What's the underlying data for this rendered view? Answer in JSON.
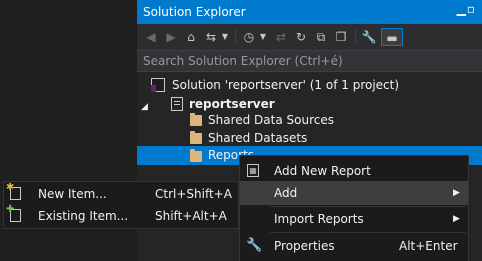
{
  "solution_explorer": {
    "title": "Solution Explorer",
    "title_pin": "–▫",
    "search_placeholder": "Search Solution Explorer (Ctrl+é)",
    "tree": {
      "solution_label": "Solution 'reportserver' (1 of 1 project)",
      "project_label": "reportserver",
      "items": [
        {
          "label": "Shared Data Sources"
        },
        {
          "label": "Shared Datasets"
        },
        {
          "label": "Reports"
        }
      ]
    },
    "toolbar_icons": [
      "back-icon",
      "forward-icon",
      "home-icon",
      "sync-view-icon",
      "dropdown-chevron-icon",
      "history-icon",
      "pending-changes-icon",
      "refresh-icon",
      "collapse-all-icon",
      "show-all-files-icon",
      "properties-icon",
      "preview-icon"
    ]
  },
  "context_menu": {
    "items": [
      {
        "label": "Add New Report",
        "shortcut": "",
        "icon": "add-report-icon"
      },
      {
        "label": "Add",
        "shortcut": "",
        "icon": "",
        "submenu": true
      },
      {
        "label": "Import Reports",
        "shortcut": "",
        "icon": "",
        "submenu": true
      },
      {
        "label": "Properties",
        "shortcut": "Alt+Enter",
        "icon": "wrench-icon"
      }
    ]
  },
  "add_submenu": {
    "items": [
      {
        "label": "New Item...",
        "shortcut": "Ctrl+Shift+A",
        "icon": "new-item-icon"
      },
      {
        "label": "Existing Item...",
        "shortcut": "Shift+Alt+A",
        "icon": "existing-item-icon"
      }
    ]
  },
  "colors": {
    "accent": "#007acc",
    "panel_bg": "#252526",
    "menu_bg": "#1b1b1c",
    "folder": "#dcb67a"
  }
}
